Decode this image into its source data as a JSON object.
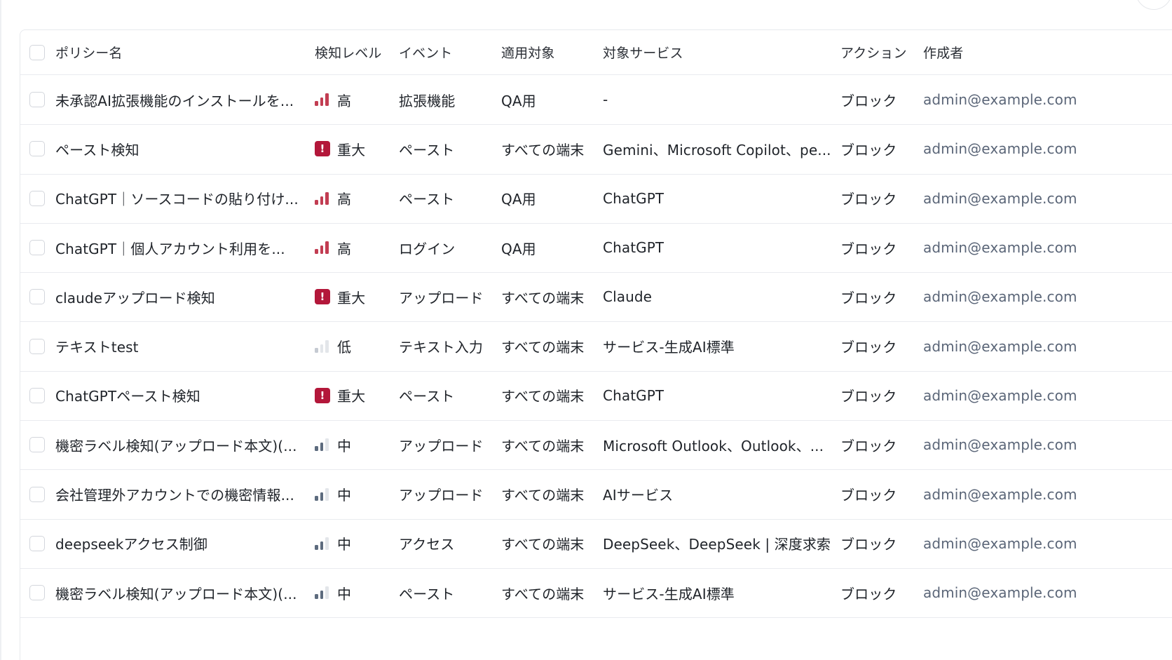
{
  "colors": {
    "high": "#c23d52",
    "critical": "#b3173a",
    "medium": "#5d6b7e",
    "low": "#c5cad2",
    "bar_inactive": "#e3e6ea"
  },
  "table": {
    "headers": {
      "name": "ポリシー名",
      "level": "検知レベル",
      "event": "イベント",
      "target": "適用対象",
      "service": "対象サービス",
      "action": "アクション",
      "author": "作成者"
    },
    "rows": [
      {
        "name": "未承認AI拡張機能のインストールを...",
        "level": "高",
        "level_type": "high",
        "event": "拡張機能",
        "target": "QA用",
        "service": "-",
        "action": "ブロック",
        "author": "admin@example.com"
      },
      {
        "name": "ペースト検知",
        "level": "重大",
        "level_type": "critical",
        "event": "ペースト",
        "target": "すべての端末",
        "service": "Gemini、Microsoft Copilot、pe...",
        "action": "ブロック",
        "author": "admin@example.com"
      },
      {
        "name": "ChatGPT｜ソースコードの貼り付け...",
        "level": "高",
        "level_type": "high",
        "event": "ペースト",
        "target": "QA用",
        "service": "ChatGPT",
        "action": "ブロック",
        "author": "admin@example.com"
      },
      {
        "name": "ChatGPT｜個人アカウント利用を...",
        "level": "高",
        "level_type": "high",
        "event": "ログイン",
        "target": "QA用",
        "service": "ChatGPT",
        "action": "ブロック",
        "author": "admin@example.com"
      },
      {
        "name": "claudeアップロード検知",
        "level": "重大",
        "level_type": "critical",
        "event": "アップロード",
        "target": "すべての端末",
        "service": "Claude",
        "action": "ブロック",
        "author": "admin@example.com"
      },
      {
        "name": "テキストtest",
        "level": "低",
        "level_type": "low",
        "event": "テキスト入力",
        "target": "すべての端末",
        "service": "サービス-生成AI標準",
        "action": "ブロック",
        "author": "admin@example.com"
      },
      {
        "name": "ChatGPTペースト検知",
        "level": "重大",
        "level_type": "critical",
        "event": "ペースト",
        "target": "すべての端末",
        "service": "ChatGPT",
        "action": "ブロック",
        "author": "admin@example.com"
      },
      {
        "name": "機密ラベル検知(アップロード本文)(...",
        "level": "中",
        "level_type": "medium",
        "event": "アップロード",
        "target": "すべての端末",
        "service": "Microsoft Outlook、Outlook、...",
        "action": "ブロック",
        "author": "admin@example.com"
      },
      {
        "name": "会社管理外アカウントでの機密情報...",
        "level": "中",
        "level_type": "medium",
        "event": "アップロード",
        "target": "すべての端末",
        "service": "AIサービス",
        "action": "ブロック",
        "author": "admin@example.com"
      },
      {
        "name": "deepseekアクセス制御",
        "level": "中",
        "level_type": "medium",
        "event": "アクセス",
        "target": "すべての端末",
        "service": "DeepSeek、DeepSeek | 深度求索",
        "action": "ブロック",
        "author": "admin@example.com"
      },
      {
        "name": "機密ラベル検知(アップロード本文)(...",
        "level": "中",
        "level_type": "medium",
        "event": "ペースト",
        "target": "すべての端末",
        "service": "サービス-生成AI標準",
        "action": "ブロック",
        "author": "admin@example.com"
      }
    ]
  }
}
